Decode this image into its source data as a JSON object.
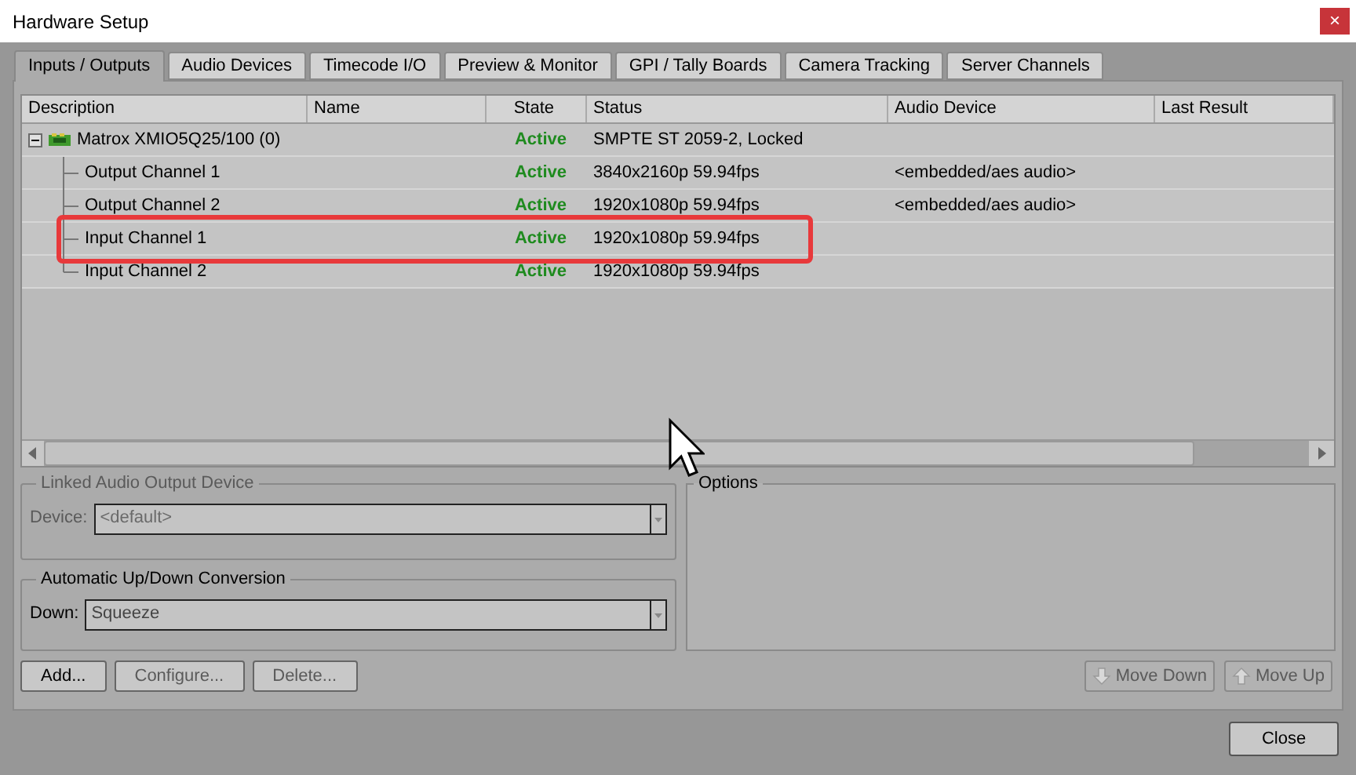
{
  "window": {
    "title": "Hardware Setup",
    "close_glyph": "×"
  },
  "tabs": [
    {
      "label": "Inputs / Outputs",
      "selected": true
    },
    {
      "label": "Audio Devices",
      "selected": false
    },
    {
      "label": "Timecode I/O",
      "selected": false
    },
    {
      "label": "Preview & Monitor",
      "selected": false
    },
    {
      "label": "GPI / Tally Boards",
      "selected": false
    },
    {
      "label": "Camera Tracking",
      "selected": false
    },
    {
      "label": "Server Channels",
      "selected": false
    }
  ],
  "table": {
    "columns": [
      "Description",
      "Name",
      "State",
      "Status",
      "Audio Device",
      "Last Result"
    ],
    "rows": [
      {
        "description": "Matrox XMIO5Q25/100 (0)",
        "state": "Active",
        "status": "SMPTE ST 2059-2, Locked",
        "expanded": true,
        "highlighted": false,
        "children": [
          {
            "description": "Output Channel 1",
            "state": "Active",
            "status": "3840x2160p 59.94fps",
            "audio_device": "<embedded/aes audio>",
            "highlighted": false
          },
          {
            "description": "Output Channel 2",
            "state": "Active",
            "status": "1920x1080p 59.94fps",
            "audio_device": "<embedded/aes audio>",
            "highlighted": false
          },
          {
            "description": "Input Channel 1",
            "state": "Active",
            "status": "1920x1080p 59.94fps",
            "highlighted": true
          },
          {
            "description": "Input Channel 2",
            "state": "Active",
            "status": "1920x1080p 59.94fps",
            "highlighted": false
          }
        ]
      }
    ]
  },
  "linked_audio": {
    "title": "Linked Audio Output Device",
    "disabled": true,
    "label": "Device:",
    "value": "<default>"
  },
  "conversion": {
    "title": "Automatic Up/Down Conversion",
    "disabled": false,
    "label": "Down:",
    "value": "Squeeze"
  },
  "options": {
    "title": "Options"
  },
  "buttons": [
    {
      "label": "Add...",
      "disabled": false
    },
    {
      "label": "Configure...",
      "disabled": true
    },
    {
      "label": "Delete...",
      "disabled": true
    }
  ],
  "move_buttons": [
    {
      "label": "Move Down",
      "kind": "down",
      "disabled": true
    },
    {
      "label": "Move Up",
      "kind": "up",
      "disabled": true
    }
  ],
  "close_button": {
    "label": "Close"
  }
}
